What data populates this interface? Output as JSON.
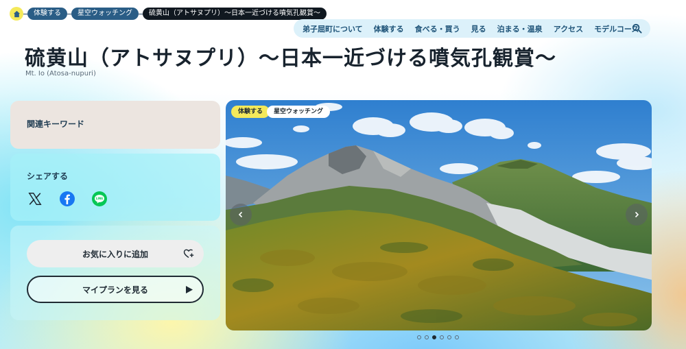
{
  "breadcrumb": {
    "home_icon": "home-icon",
    "items": [
      "体験する",
      "星空ウォッチング"
    ],
    "current": "硫黄山（アトサヌプリ）〜日本一近づける噴気孔観賞〜"
  },
  "nav": {
    "items": [
      "弟子屈町について",
      "体験する",
      "食べる・買う",
      "見る",
      "泊まる・温泉",
      "アクセス",
      "モデルコース"
    ],
    "search_icon": "search-icon"
  },
  "page": {
    "title": "硫黄山（アトサヌプリ）〜日本一近づける噴気孔観賞〜",
    "subtitle": "Mt. Io (Atosa-nupuri)"
  },
  "keywords": {
    "label": "関連キーワード"
  },
  "share": {
    "label": "シェアする",
    "icons": [
      "x-icon",
      "facebook-icon",
      "line-icon"
    ]
  },
  "actions": {
    "favorite_label": "お気に入りに追加",
    "plan_label": "マイプランを見る"
  },
  "hero": {
    "tags": [
      "体験する",
      "星空ウォッチング"
    ],
    "slide_index": 3,
    "slide_count": 6
  },
  "colors": {
    "accent_yellow": "#f4e95a",
    "nav_blue": "#2a5d86",
    "dark": "#101820"
  }
}
